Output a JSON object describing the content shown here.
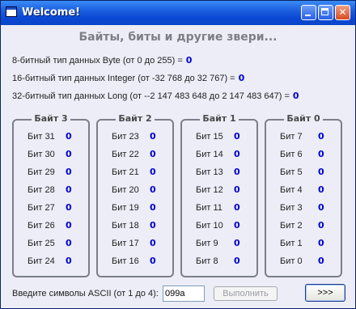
{
  "window": {
    "title": "Welcome!"
  },
  "heading": "Байты, биты и другие звери...",
  "info": [
    {
      "text": "8-битный тип данных Byte (от 0 до 255) =",
      "value": "0"
    },
    {
      "text": "16-битный тип данных Integer (от -32 768 до 32 767) =",
      "value": "0"
    },
    {
      "text": "32-битный тип данных Long (от --2 147 483 648 до 2 147 483 647) =",
      "value": "0"
    }
  ],
  "bytes": [
    {
      "title": "Байт 3",
      "bits": [
        {
          "label": "Бит 31",
          "value": "0"
        },
        {
          "label": "Бит 30",
          "value": "0"
        },
        {
          "label": "Бит 29",
          "value": "0"
        },
        {
          "label": "Бит 28",
          "value": "0"
        },
        {
          "label": "Бит 27",
          "value": "0"
        },
        {
          "label": "Бит 26",
          "value": "0"
        },
        {
          "label": "Бит 25",
          "value": "0"
        },
        {
          "label": "Бит 24",
          "value": "0"
        }
      ]
    },
    {
      "title": "Байт 2",
      "bits": [
        {
          "label": "Бит 23",
          "value": "0"
        },
        {
          "label": "Бит 22",
          "value": "0"
        },
        {
          "label": "Бит 21",
          "value": "0"
        },
        {
          "label": "Бит 20",
          "value": "0"
        },
        {
          "label": "Бит 19",
          "value": "0"
        },
        {
          "label": "Бит 18",
          "value": "0"
        },
        {
          "label": "Бит 17",
          "value": "0"
        },
        {
          "label": "Бит 16",
          "value": "0"
        }
      ]
    },
    {
      "title": "Байт 1",
      "bits": [
        {
          "label": "Бит 15",
          "value": "0"
        },
        {
          "label": "Бит 14",
          "value": "0"
        },
        {
          "label": "Бит 13",
          "value": "0"
        },
        {
          "label": "Бит 12",
          "value": "0"
        },
        {
          "label": "Бит 11",
          "value": "0"
        },
        {
          "label": "Бит 10",
          "value": "0"
        },
        {
          "label": "Бит 9",
          "value": "0"
        },
        {
          "label": "Бит 8",
          "value": "0"
        }
      ]
    },
    {
      "title": "Байт 0",
      "bits": [
        {
          "label": "Бит 7",
          "value": "0"
        },
        {
          "label": "Бит 6",
          "value": "0"
        },
        {
          "label": "Бит 5",
          "value": "0"
        },
        {
          "label": "Бит 4",
          "value": "0"
        },
        {
          "label": "Бит 3",
          "value": "0"
        },
        {
          "label": "Бит 2",
          "value": "0"
        },
        {
          "label": "Бит 1",
          "value": "0"
        },
        {
          "label": "Бит 0",
          "value": "0"
        }
      ]
    }
  ],
  "input": {
    "label": "Введите символы ASCII (от 1 до 4):",
    "value": "099a"
  },
  "buttons": {
    "run": "Выполнить",
    "next": ">>>"
  },
  "colors": {
    "value_blue": "#0000cc",
    "titlebar_blue": "#0a48d4"
  },
  "icons": {
    "app": "window-icon",
    "minimize": "minimize-icon",
    "maximize": "maximize-icon",
    "close": "close-icon"
  }
}
